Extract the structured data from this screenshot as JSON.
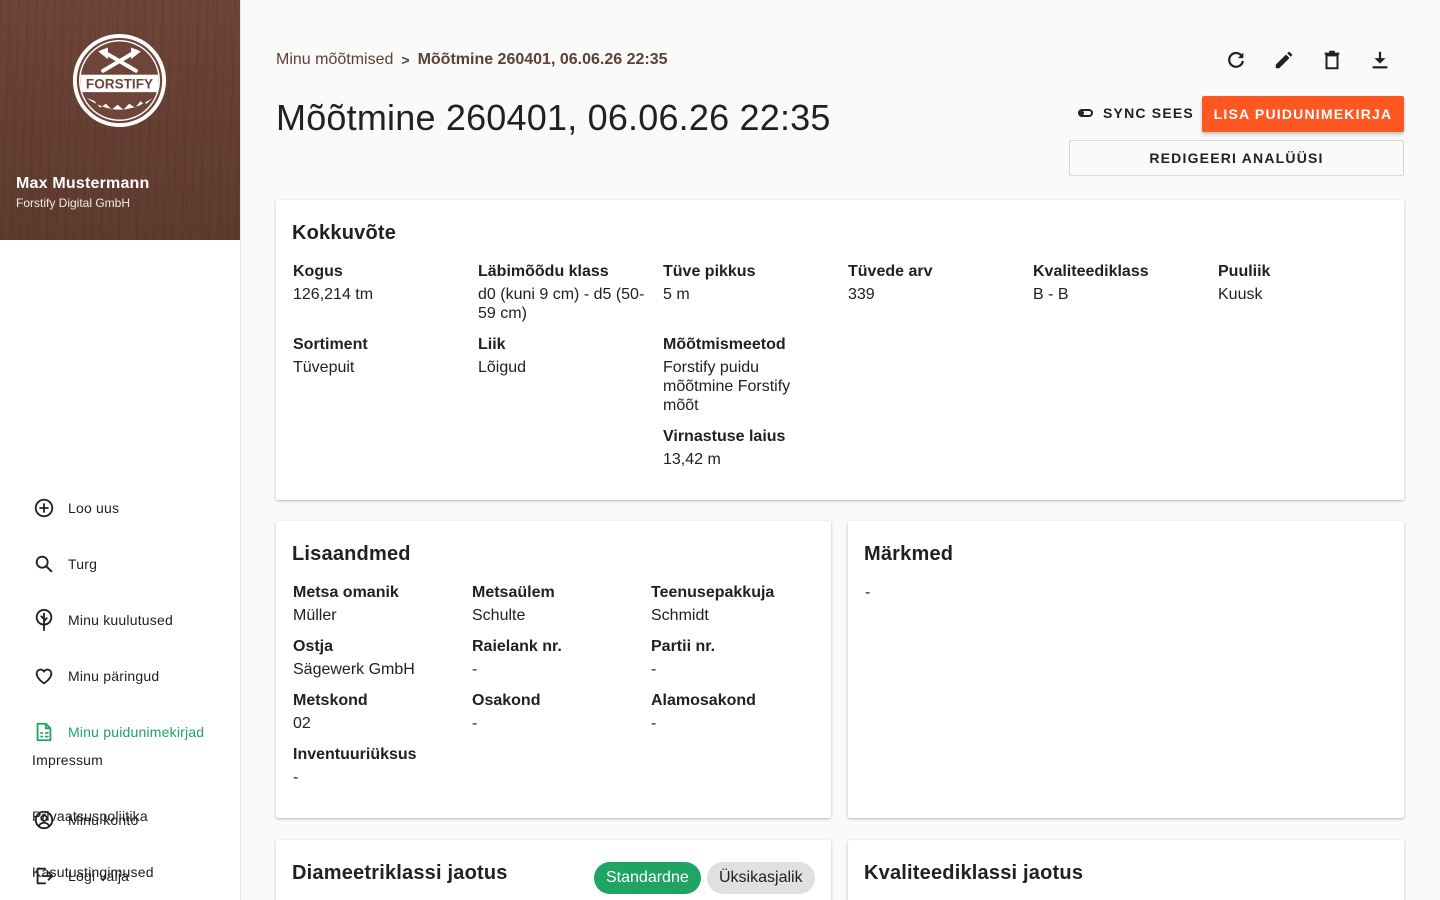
{
  "sidebar": {
    "logo_text": "FORSTIFY",
    "user_name": "Max Mustermann",
    "company": "Forstify Digital GmbH",
    "nav": [
      {
        "label": "Loo uus",
        "icon": "add-circle-icon",
        "active": false
      },
      {
        "label": "Turg",
        "icon": "search-icon",
        "active": false
      },
      {
        "label": "Minu kuulutused",
        "icon": "tree-icon",
        "active": false
      },
      {
        "label": "Minu päringud",
        "icon": "heart-icon",
        "active": false
      },
      {
        "label": "Minu puidunimekirjad",
        "icon": "document-list-icon",
        "active": true
      },
      {
        "label": "Minu konto",
        "icon": "account-circle-icon",
        "active": false
      },
      {
        "label": "Logi välja",
        "icon": "logout-icon",
        "active": false
      }
    ],
    "footer": [
      "Impressum",
      "Privaatsuspoliitika",
      "Kasutustingimused"
    ]
  },
  "header": {
    "breadcrumb_parent": "Minu mõõtmised",
    "breadcrumb_sep": ">",
    "breadcrumb_current": "Mõõtmine 260401, 06.06.26 22:35",
    "title": "Mõõtmine 260401, 06.06.26 22:35",
    "toolbar": [
      "refresh-icon",
      "edit-icon",
      "delete-icon",
      "download-icon"
    ],
    "sync_label": "SYNC SEES",
    "primary_button": "LISA PUIDUNIMEKIRJA",
    "secondary_button": "REDIGEERI ANALÜÜSI"
  },
  "summary": {
    "title": "Kokkuvõte",
    "fields": [
      {
        "label": "Kogus",
        "value": "126,214 tm"
      },
      {
        "label": "Läbimõõdu klass",
        "value": "d0 (kuni 9 cm) - d5 (50-59 cm)"
      },
      {
        "label": "Tüve pikkus",
        "value": "5 m"
      },
      {
        "label": "Tüvede arv",
        "value": "339"
      },
      {
        "label": "Kvaliteediklass",
        "value": "B - B"
      },
      {
        "label": "Puuliik",
        "value": "Kuusk"
      },
      {
        "label": "Sortiment",
        "value": "Tüvepuit"
      },
      {
        "label": "Liik",
        "value": "Lõigud"
      },
      {
        "label": "Mõõtmismeetod",
        "value": "Forstify puidu mõõtmine Forstify mõõt"
      },
      {
        "label": "Virnastuse laius",
        "value": "13,42 m"
      }
    ]
  },
  "extra": {
    "title": "Lisaandmed",
    "fields": [
      {
        "label": "Metsa omanik",
        "value": "Müller"
      },
      {
        "label": "Metsaülem",
        "value": "Schulte"
      },
      {
        "label": "Teenusepakkuja",
        "value": "Schmidt"
      },
      {
        "label": "Ostja",
        "value": "Sägewerk GmbH"
      },
      {
        "label": "Raielank nr.",
        "value": "-"
      },
      {
        "label": "Partii nr.",
        "value": "-"
      },
      {
        "label": "Metskond",
        "value": "02"
      },
      {
        "label": "Osakond",
        "value": "-"
      },
      {
        "label": "Alamosakond",
        "value": "-"
      },
      {
        "label": "Inventuuriüksus",
        "value": "-"
      }
    ]
  },
  "notes": {
    "title": "Märkmed",
    "value": "-"
  },
  "diameter": {
    "title": "Diameetriklassi jaotus",
    "chip_standard": "Standardne",
    "chip_detailed": "Üksikasjalik"
  },
  "quality": {
    "title": "Kvaliteediklassi jaotus"
  },
  "colors": {
    "accent": "#ff5722",
    "active_green": "#1fa463",
    "header_brown": "#6e4538"
  }
}
